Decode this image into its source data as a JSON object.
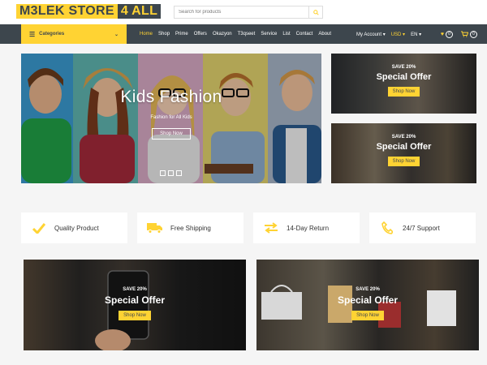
{
  "header": {
    "logo_part1": "M3LEK STORE",
    "logo_part2": "4 ALL",
    "search_placeholder": "Search for products"
  },
  "nav": {
    "categories_label": "Categories",
    "links": [
      "Home",
      "Shop",
      "Prime",
      "Offers",
      "Okazyon",
      "T3qseet",
      "Service",
      "List",
      "Contact",
      "About"
    ],
    "account_label": "My Account",
    "currency_label": "USD",
    "language_label": "EN",
    "wishlist_count": "0",
    "cart_count": "0"
  },
  "hero": {
    "title": "Kids Fashion",
    "subtitle": "Fashion for All Kids",
    "button": "Shop Now"
  },
  "offers": [
    {
      "save": "SAVE 20%",
      "title": "Special Offer",
      "button": "Shop Now"
    },
    {
      "save": "SAVE 20%",
      "title": "Special Offer",
      "button": "Shop Now"
    },
    {
      "save": "SAVE 20%",
      "title": "Special Offer",
      "button": "Shop Now"
    },
    {
      "save": "SAVE 20%",
      "title": "Special Offer",
      "button": "Shop Now"
    }
  ],
  "features": [
    {
      "label": "Quality Product",
      "icon": "check-icon"
    },
    {
      "label": "Free Shipping",
      "icon": "truck-icon"
    },
    {
      "label": "14-Day Return",
      "icon": "exchange-icon"
    },
    {
      "label": "24/7 Support",
      "icon": "phone-icon"
    }
  ],
  "colors": {
    "accent": "#ffd333",
    "dark": "#3d464d",
    "background": "#f5f5f5"
  }
}
